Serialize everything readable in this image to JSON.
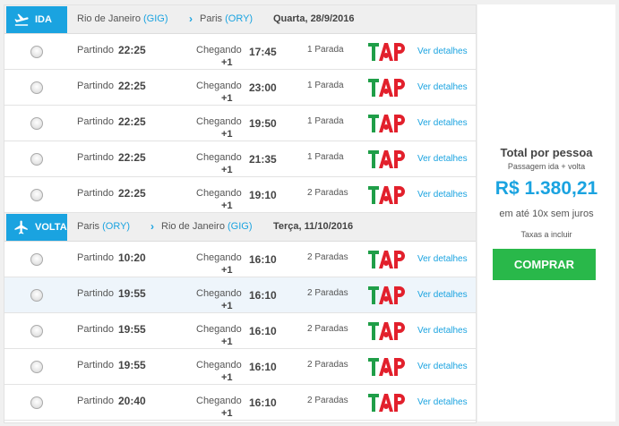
{
  "outbound": {
    "badge": "IDA",
    "origin_city": "Rio de Janeiro",
    "origin_code": "(GIG)",
    "dest_city": "Paris",
    "dest_code": "(ORY)",
    "arrow": "›",
    "date": "Quarta, 28/9/2016",
    "flights": [
      {
        "dep_label": "Partindo",
        "dep_time": "22:25",
        "arr_label": "Chegando",
        "arr_plus": "+1",
        "arr_time": "17:45",
        "stops": "1 Parada",
        "details": "Ver detalhes"
      },
      {
        "dep_label": "Partindo",
        "dep_time": "22:25",
        "arr_label": "Chegando",
        "arr_plus": "+1",
        "arr_time": "23:00",
        "stops": "1 Parada",
        "details": "Ver detalhes"
      },
      {
        "dep_label": "Partindo",
        "dep_time": "22:25",
        "arr_label": "Chegando",
        "arr_plus": "+1",
        "arr_time": "19:50",
        "stops": "1 Parada",
        "details": "Ver detalhes"
      },
      {
        "dep_label": "Partindo",
        "dep_time": "22:25",
        "arr_label": "Chegando",
        "arr_plus": "+1",
        "arr_time": "21:35",
        "stops": "1 Parada",
        "details": "Ver detalhes"
      },
      {
        "dep_label": "Partindo",
        "dep_time": "22:25",
        "arr_label": "Chegando",
        "arr_plus": "+1",
        "arr_time": "19:10",
        "stops": "2 Paradas",
        "details": "Ver detalhes"
      }
    ]
  },
  "return": {
    "badge": "VOLTA",
    "origin_city": "Paris",
    "origin_code": "(ORY)",
    "dest_city": "Rio de Janeiro",
    "dest_code": "(GIG)",
    "arrow": "›",
    "date": "Terça, 11/10/2016",
    "flights": [
      {
        "dep_label": "Partindo",
        "dep_time": "10:20",
        "arr_label": "Chegando",
        "arr_plus": "+1",
        "arr_time": "16:10",
        "stops": "2 Paradas",
        "details": "Ver detalhes"
      },
      {
        "dep_label": "Partindo",
        "dep_time": "19:55",
        "arr_label": "Chegando",
        "arr_plus": "+1",
        "arr_time": "16:10",
        "stops": "2 Paradas",
        "details": "Ver detalhes"
      },
      {
        "dep_label": "Partindo",
        "dep_time": "19:55",
        "arr_label": "Chegando",
        "arr_plus": "+1",
        "arr_time": "16:10",
        "stops": "2 Paradas",
        "details": "Ver detalhes"
      },
      {
        "dep_label": "Partindo",
        "dep_time": "19:55",
        "arr_label": "Chegando",
        "arr_plus": "+1",
        "arr_time": "16:10",
        "stops": "2 Paradas",
        "details": "Ver detalhes"
      },
      {
        "dep_label": "Partindo",
        "dep_time": "20:40",
        "arr_label": "Chegando",
        "arr_plus": "+1",
        "arr_time": "16:10",
        "stops": "2 Paradas",
        "details": "Ver detalhes"
      }
    ]
  },
  "airline": {
    "logo_icon": "tap-airline-logo",
    "logo_text": "TAP"
  },
  "summary": {
    "title": "Total por pessoa",
    "subtitle": "Passagem ida + volta",
    "price": "R$ 1.380,21",
    "installments": "em até 10x sem juros",
    "taxes": "Taxas a incluir",
    "buy_label": "COMPRAR"
  },
  "colors": {
    "accent": "#1aa3e0",
    "buy": "#29b84a",
    "tap_green": "#1f9e48",
    "tap_red": "#e2202c"
  }
}
